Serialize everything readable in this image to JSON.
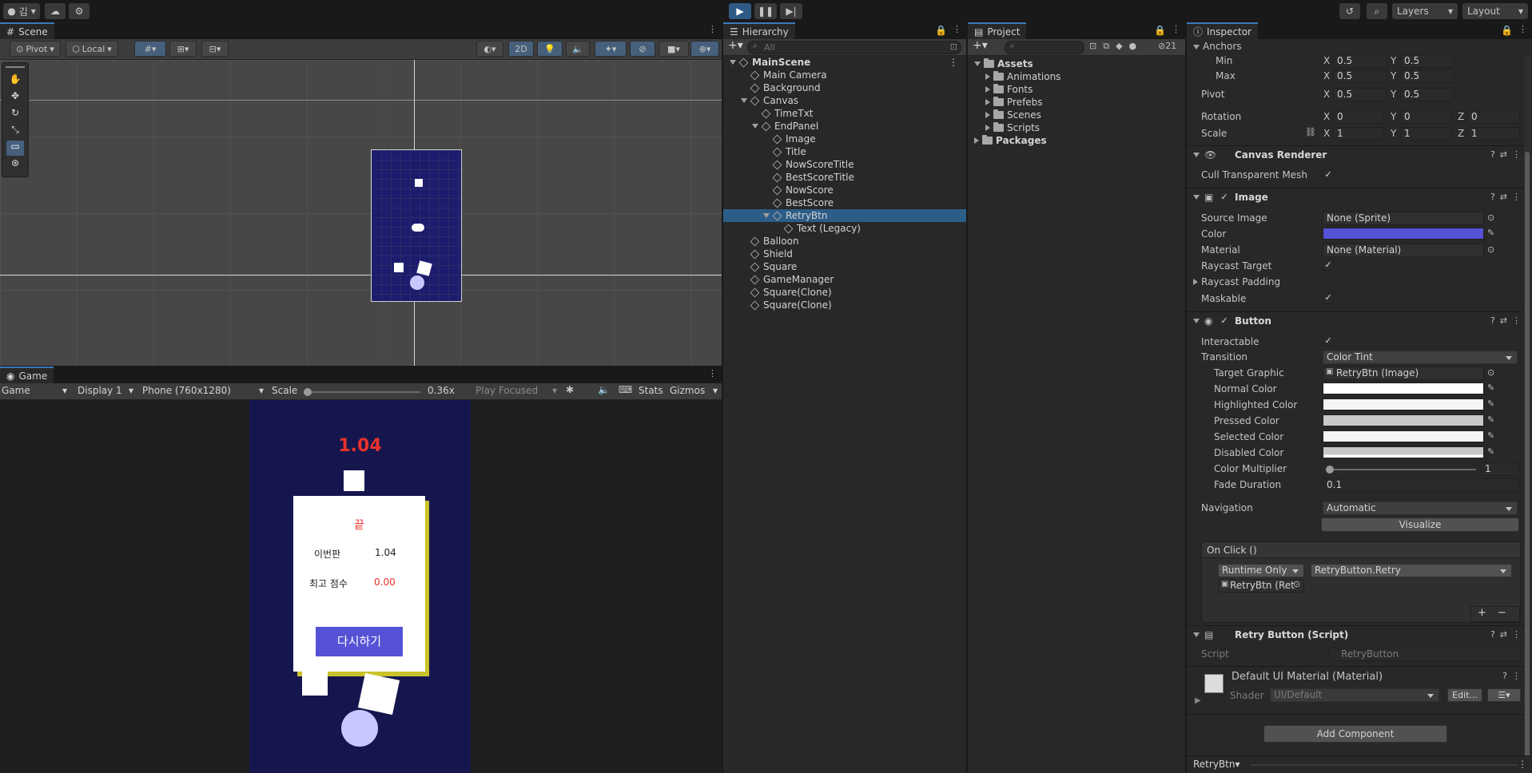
{
  "topbar": {
    "account": "김",
    "layers": "Layers",
    "layout": "Layout"
  },
  "scene": {
    "tab": "Scene",
    "pivot": "Pivot",
    "local": "Local",
    "mode_2d": "2D"
  },
  "game": {
    "tab": "Game",
    "view": "Game",
    "display": "Display 1",
    "resolution": "Phone (760x1280)",
    "scale_label": "Scale",
    "scale_value": "0.36x",
    "play_mode": "Play Focused",
    "stats": "Stats",
    "gizmos": "Gizmos",
    "screen": {
      "timer": "1.04",
      "end_title": "끝",
      "now_label": "이번판",
      "now_value": "1.04",
      "best_label": "최고 점수",
      "best_value": "0.00",
      "retry_label": "다시하기"
    }
  },
  "hierarchy": {
    "tab": "Hierarchy",
    "search_placeholder": "All",
    "items": [
      {
        "label": "MainScene",
        "depth": 0,
        "type": "scene"
      },
      {
        "label": "Main Camera",
        "depth": 1
      },
      {
        "label": "Background",
        "depth": 1
      },
      {
        "label": "Canvas",
        "depth": 1,
        "expanded": true
      },
      {
        "label": "TimeTxt",
        "depth": 2
      },
      {
        "label": "EndPanel",
        "depth": 2,
        "expanded": true
      },
      {
        "label": "Image",
        "depth": 3
      },
      {
        "label": "Title",
        "depth": 3
      },
      {
        "label": "NowScoreTitle",
        "depth": 3
      },
      {
        "label": "BestScoreTitle",
        "depth": 3
      },
      {
        "label": "NowScore",
        "depth": 3
      },
      {
        "label": "BestScore",
        "depth": 3
      },
      {
        "label": "RetryBtn",
        "depth": 3,
        "expanded": true,
        "selected": true
      },
      {
        "label": "Text (Legacy)",
        "depth": 4
      },
      {
        "label": "Balloon",
        "depth": 1
      },
      {
        "label": "Shield",
        "depth": 1
      },
      {
        "label": "Square",
        "depth": 1
      },
      {
        "label": "GameManager",
        "depth": 1
      },
      {
        "label": "Square(Clone)",
        "depth": 1
      },
      {
        "label": "Square(Clone)",
        "depth": 1
      }
    ]
  },
  "project": {
    "tab": "Project",
    "hidden_count": "21",
    "items": [
      {
        "label": "Assets",
        "depth": 0,
        "expanded": true
      },
      {
        "label": "Animations",
        "depth": 1
      },
      {
        "label": "Fonts",
        "depth": 1
      },
      {
        "label": "Prefebs",
        "depth": 1
      },
      {
        "label": "Scenes",
        "depth": 1
      },
      {
        "label": "Scripts",
        "depth": 1
      },
      {
        "label": "Packages",
        "depth": 0
      }
    ]
  },
  "inspector": {
    "tab": "Inspector",
    "anchors": {
      "label": "Anchors",
      "min": "Min",
      "max": "Max",
      "min_x": "0.5",
      "min_y": "0.5",
      "max_x": "0.5",
      "max_y": "0.5"
    },
    "pivot": {
      "label": "Pivot",
      "x": "0.5",
      "y": "0.5"
    },
    "rotation": {
      "label": "Rotation",
      "x": "0",
      "y": "0",
      "z": "0"
    },
    "scale": {
      "label": "Scale",
      "x": "1",
      "y": "1",
      "z": "1"
    },
    "axes": {
      "x": "X",
      "y": "Y",
      "z": "Z"
    },
    "canvas_renderer": {
      "title": "Canvas Renderer",
      "cull": "Cull Transparent Mesh"
    },
    "image": {
      "title": "Image",
      "source_image": "Source Image",
      "source_value": "None (Sprite)",
      "color": "Color",
      "color_value": "#5552d6",
      "material": "Material",
      "material_value": "None (Material)",
      "raycast_target": "Raycast Target",
      "raycast_padding": "Raycast Padding",
      "maskable": "Maskable"
    },
    "button": {
      "title": "Button",
      "interactable": "Interactable",
      "transition": "Transition",
      "transition_value": "Color Tint",
      "target_graphic": "Target Graphic",
      "target_value": "RetryBtn (Image)",
      "normal": "Normal Color",
      "highlighted": "Highlighted Color",
      "pressed": "Pressed Color",
      "selected": "Selected Color",
      "disabled": "Disabled Color",
      "multiplier": "Color Multiplier",
      "multiplier_value": "1",
      "fade": "Fade Duration",
      "fade_value": "0.1",
      "navigation": "Navigation",
      "navigation_value": "Automatic",
      "visualize": "Visualize",
      "onclick": "On Click ()",
      "runtime": "Runtime Only",
      "method": "RetryButton.Retry",
      "target_obj": "RetryBtn (Ret"
    },
    "script": {
      "title": "Retry Button (Script)",
      "label": "Script",
      "value": "RetryButton"
    },
    "material": {
      "title": "Default UI Material (Material)",
      "shader_label": "Shader",
      "shader_value": "UI/Default",
      "edit": "Edit..."
    },
    "add_component": "Add Component",
    "footer": "RetryBtn"
  },
  "colors": {
    "accent": "#2c5d87",
    "game_bg": "#16164e",
    "retry": "#5552d6",
    "timer": "#e8322a",
    "shadow": "#c9c22a"
  }
}
